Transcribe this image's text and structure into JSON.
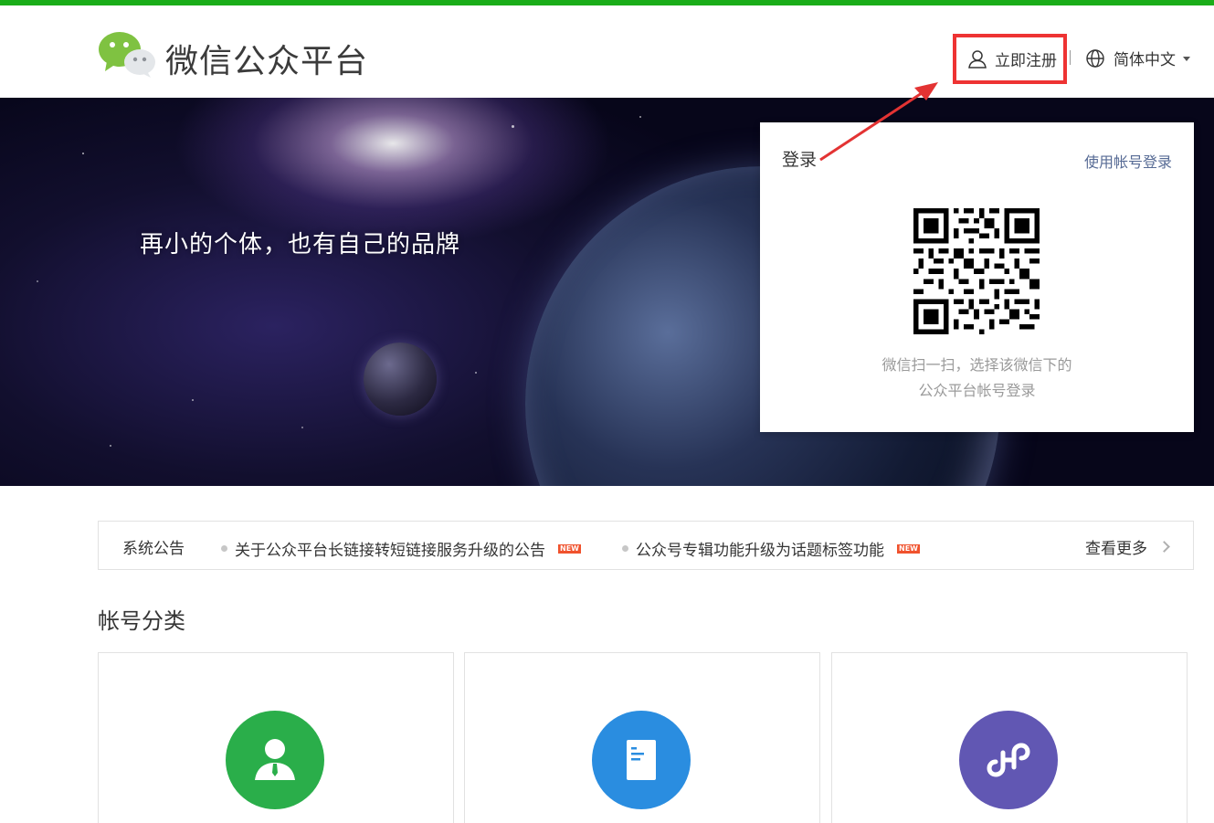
{
  "header": {
    "brand": "微信公众平台",
    "register_label": "立即注册",
    "language_label": "简体中文"
  },
  "banner": {
    "slogan": "再小的个体，也有自己的品牌"
  },
  "login": {
    "title": "登录",
    "account_login_link": "使用帐号登录",
    "qr_tip_line1": "微信扫一扫，选择该微信下的",
    "qr_tip_line2": "公众平台帐号登录"
  },
  "notice": {
    "title": "系统公告",
    "items": [
      {
        "text": "关于公众平台长链接转短链接服务升级的公告",
        "badge": "NEW"
      },
      {
        "text": "公众号专辑功能升级为话题标签功能",
        "badge": "NEW"
      }
    ],
    "more_label": "查看更多"
  },
  "accounts": {
    "title": "帐号分类",
    "cards": [
      {
        "icon": "service-account-icon",
        "color": "#2aae4a"
      },
      {
        "icon": "subscription-account-icon",
        "color": "#2a8de0"
      },
      {
        "icon": "mini-program-icon",
        "color": "#6157b3"
      }
    ]
  },
  "colors": {
    "accent_green": "#1aad19",
    "link_blue": "#576b95",
    "highlight_red": "#e33333"
  }
}
